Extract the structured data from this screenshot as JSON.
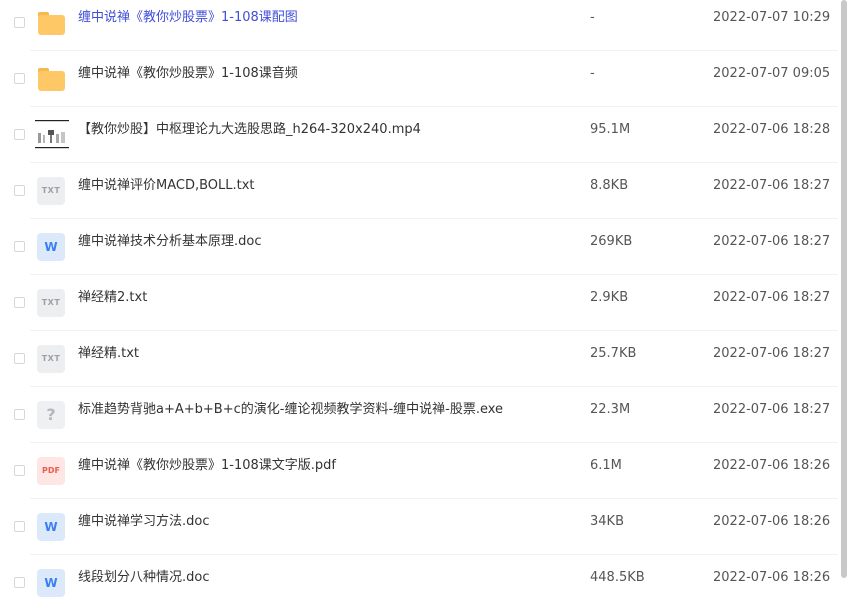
{
  "files": [
    {
      "name": "缠中说禅《教你炒股票》1-108课配图",
      "size": "-",
      "date": "2022-07-07 10:29",
      "type": "folder",
      "highlight": true
    },
    {
      "name": "缠中说禅《教你炒股票》1-108课音频",
      "size": "-",
      "date": "2022-07-07 09:05",
      "type": "folder"
    },
    {
      "name": "【教你炒股】中枢理论九大选股思路_h264-320x240.mp4",
      "size": "95.1M",
      "date": "2022-07-06 18:28",
      "type": "video"
    },
    {
      "name": "缠中说禅评价MACD,BOLL.txt",
      "size": "8.8KB",
      "date": "2022-07-06 18:27",
      "type": "txt",
      "icon_text": "TXT"
    },
    {
      "name": "缠中说禅技术分析基本原理.doc",
      "size": "269KB",
      "date": "2022-07-06 18:27",
      "type": "word",
      "icon_text": "W"
    },
    {
      "name": "禅经精2.txt",
      "size": "2.9KB",
      "date": "2022-07-06 18:27",
      "type": "txt",
      "icon_text": "TXT"
    },
    {
      "name": "禅经精.txt",
      "size": "25.7KB",
      "date": "2022-07-06 18:27",
      "type": "txt",
      "icon_text": "TXT"
    },
    {
      "name": "标准趋势背驰a+A+b+B+c的演化-缠论视频教学资料-缠中说禅-股票.exe",
      "size": "22.3M",
      "date": "2022-07-06 18:27",
      "type": "unknown",
      "icon_text": "?"
    },
    {
      "name": "缠中说禅《教你炒股票》1-108课文字版.pdf",
      "size": "6.1M",
      "date": "2022-07-06 18:26",
      "type": "pdf",
      "icon_text": "PDF"
    },
    {
      "name": "缠中说禅学习方法.doc",
      "size": "34KB",
      "date": "2022-07-06 18:26",
      "type": "word",
      "icon_text": "W"
    },
    {
      "name": "线段划分八种情况.doc",
      "size": "448.5KB",
      "date": "2022-07-06 18:26",
      "type": "word",
      "icon_text": "W"
    }
  ],
  "colors": {
    "link": "#3f4ed9",
    "folder": "#ffc867",
    "word": "#3b7ff0",
    "pdf": "#ee5b4d"
  }
}
